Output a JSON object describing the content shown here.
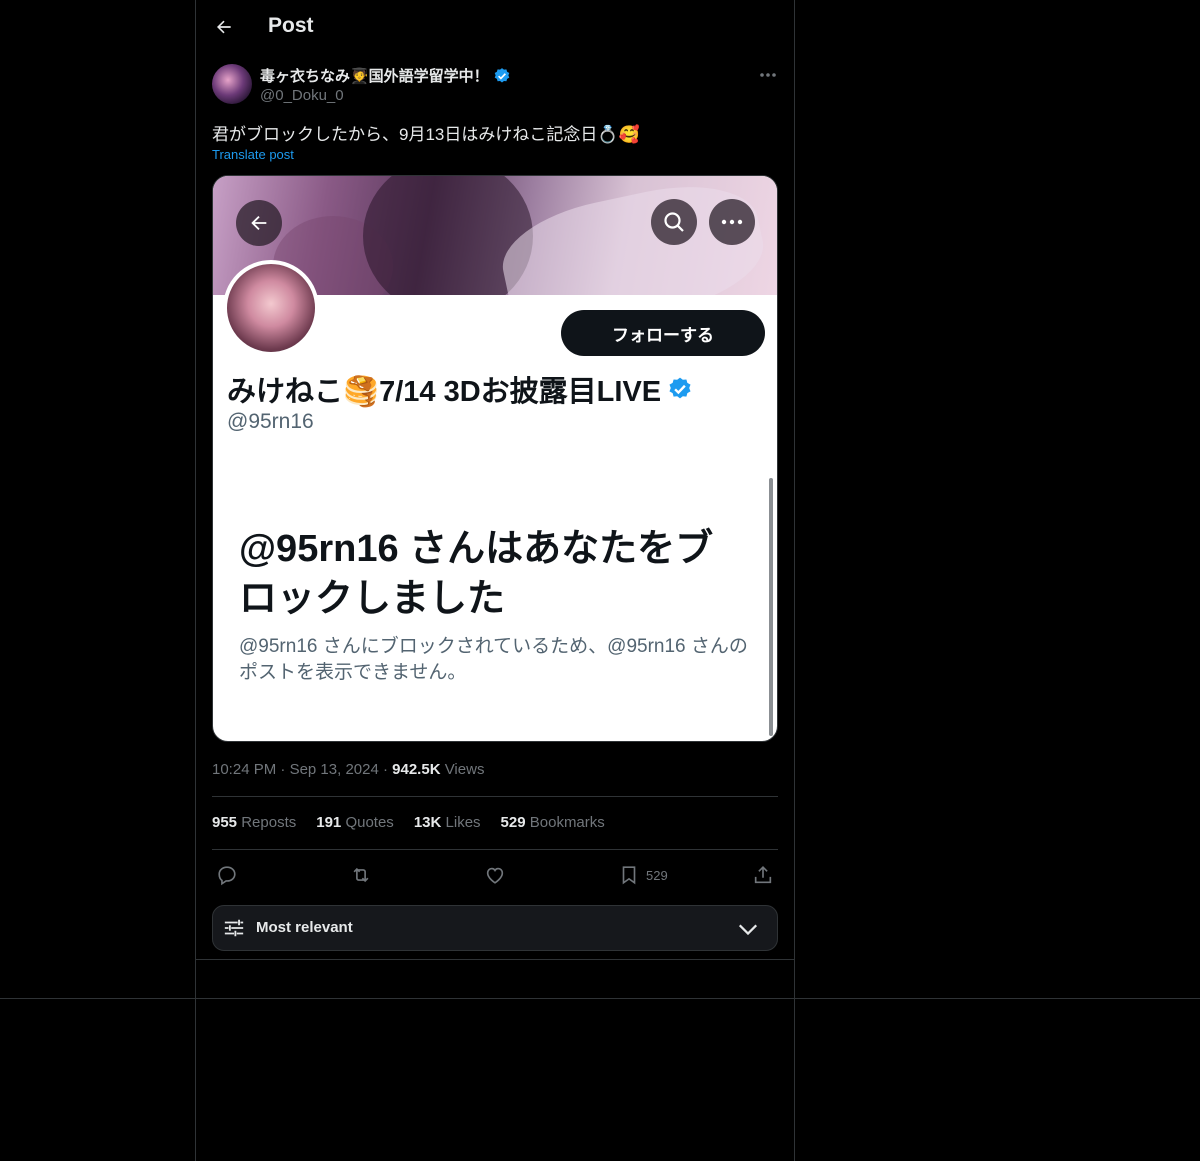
{
  "header": {
    "title": "Post"
  },
  "post": {
    "author_name": "毒ヶ衣ちなみ🧑‍🎓国外語学留学中！",
    "author_handle": "@0_Doku_0",
    "text": "君がブロックしたから、9月13日はみけねこ記念日💍🥰",
    "translate_label": "Translate post",
    "time": "10:24 PM",
    "date": "Sep 13, 2024",
    "views_count": "942.5K",
    "views_label": "Views",
    "separator": "·"
  },
  "media": {
    "follow_label": "フォローする",
    "profile_name": "みけねこ🥞7/14 3Dお披露目LIVE",
    "profile_handle": "@95rn16",
    "block_title": "@95rn16 さんはあなたをブロックしました",
    "block_desc": "@95rn16 さんにブロックされているため、@95rn16 さんのポストを表示できません。"
  },
  "stats": {
    "reposts_count": "955",
    "reposts_label": "Reposts",
    "quotes_count": "191",
    "quotes_label": "Quotes",
    "likes_count": "13K",
    "likes_label": "Likes",
    "bookmarks_count": "529",
    "bookmarks_label": "Bookmarks"
  },
  "actions": {
    "bookmark_count": "529"
  },
  "sort": {
    "label": "Most relevant"
  },
  "icons": [
    "back-arrow-icon",
    "verified-badge-icon",
    "more-icon",
    "reply-icon",
    "repost-icon",
    "like-icon",
    "bookmark-icon",
    "share-icon",
    "sliders-icon",
    "chevron-down-icon",
    "search-icon"
  ],
  "colors": {
    "accent": "#1d9bf0",
    "background": "#000000",
    "muted": "#71767b",
    "border": "#2f3336"
  }
}
